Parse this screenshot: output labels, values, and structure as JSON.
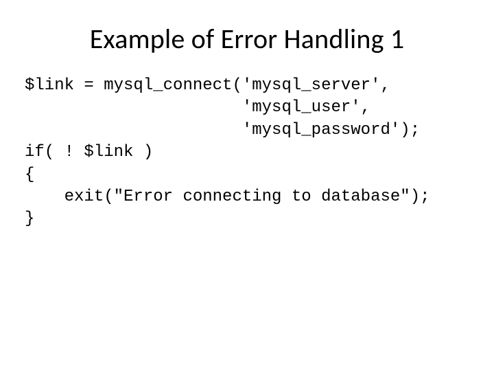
{
  "title": "Example of Error Handling 1",
  "code": {
    "l1": "$link = mysql_connect('mysql_server',",
    "l2": "                      'mysql_user',",
    "l3": "                      'mysql_password');",
    "l4": "if( ! $link )",
    "l5": "{",
    "l6": "    exit(\"Error connecting to database\");",
    "l7": "}"
  }
}
